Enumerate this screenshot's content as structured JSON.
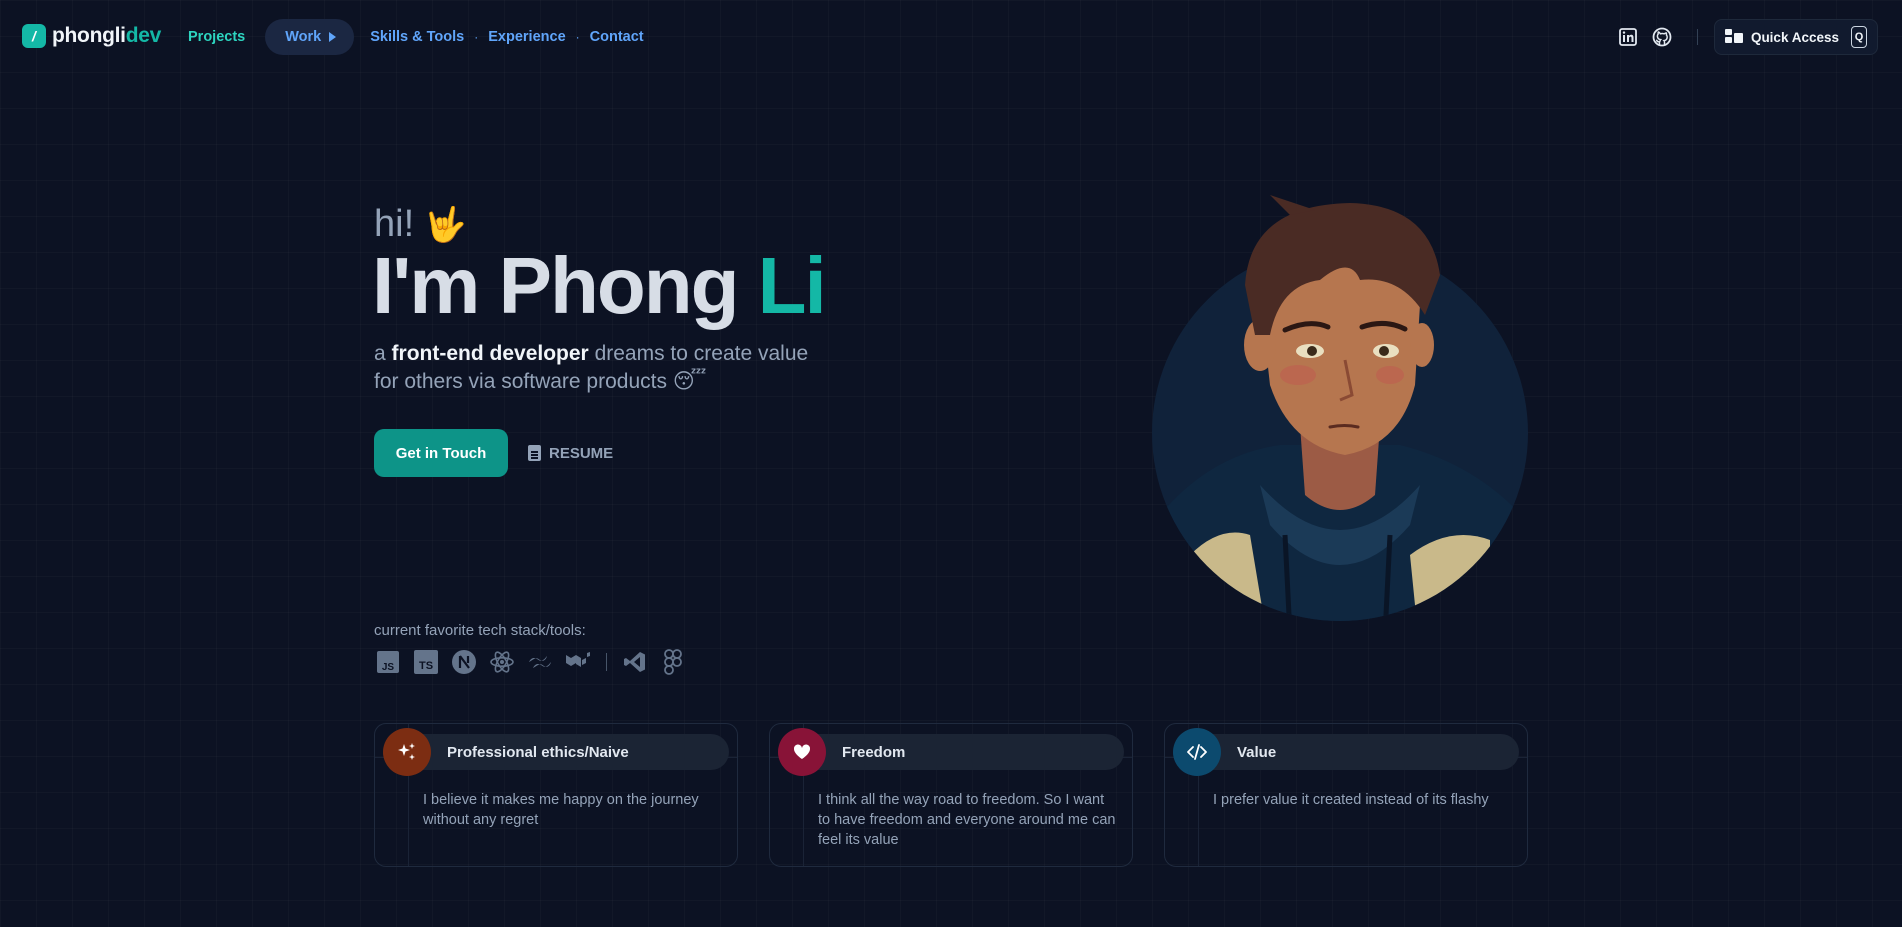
{
  "nav": {
    "logo": {
      "prefix": "phongli",
      "accent": "dev",
      "badge": "/"
    },
    "links": {
      "projects": "Projects",
      "work": "Work",
      "skills": "Skills & Tools",
      "experience": "Experience",
      "contact": "Contact"
    },
    "separator": "·",
    "social_icons": [
      "linkedin-icon",
      "github-icon"
    ],
    "quick_access": {
      "label": "Quick Access",
      "shortcut": "Q"
    }
  },
  "hero": {
    "greeting": "hi!",
    "greeting_emoji": "🤟",
    "title_main": "I'm Phong",
    "title_accent": "Li",
    "tagline_prefix": "a",
    "tagline_bold": "front-end developer",
    "tagline_rest": "dreams to create value for others via software products",
    "tagline_emoji": "😴",
    "cta_primary": "Get in Touch",
    "cta_secondary": "RESUME"
  },
  "stack": {
    "label": "current favorite tech stack/tools:",
    "icons": [
      "javascript-icon",
      "typescript-icon",
      "nextjs-icon",
      "react-icon",
      "tailwind-icon",
      "mui-icon",
      "vscode-icon",
      "figma-icon"
    ]
  },
  "cards": [
    {
      "title": "Professional ethics/Naive",
      "body": "I believe it makes me happy on the journey without any regret",
      "icon": "sparkles-icon",
      "color": "#7c2d12"
    },
    {
      "title": "Freedom",
      "body": "I think all the way road to freedom. So I want to have freedom and everyone around me can feel its value",
      "icon": "heart-icon",
      "color": "#881337"
    },
    {
      "title": "Value",
      "body": "I prefer value it created instead of its flashy",
      "icon": "code-icon",
      "color": "#0c4a6e"
    }
  ],
  "colors": {
    "accent": "#14b8a6",
    "link": "#60a5fa",
    "background": "#0c1223"
  }
}
